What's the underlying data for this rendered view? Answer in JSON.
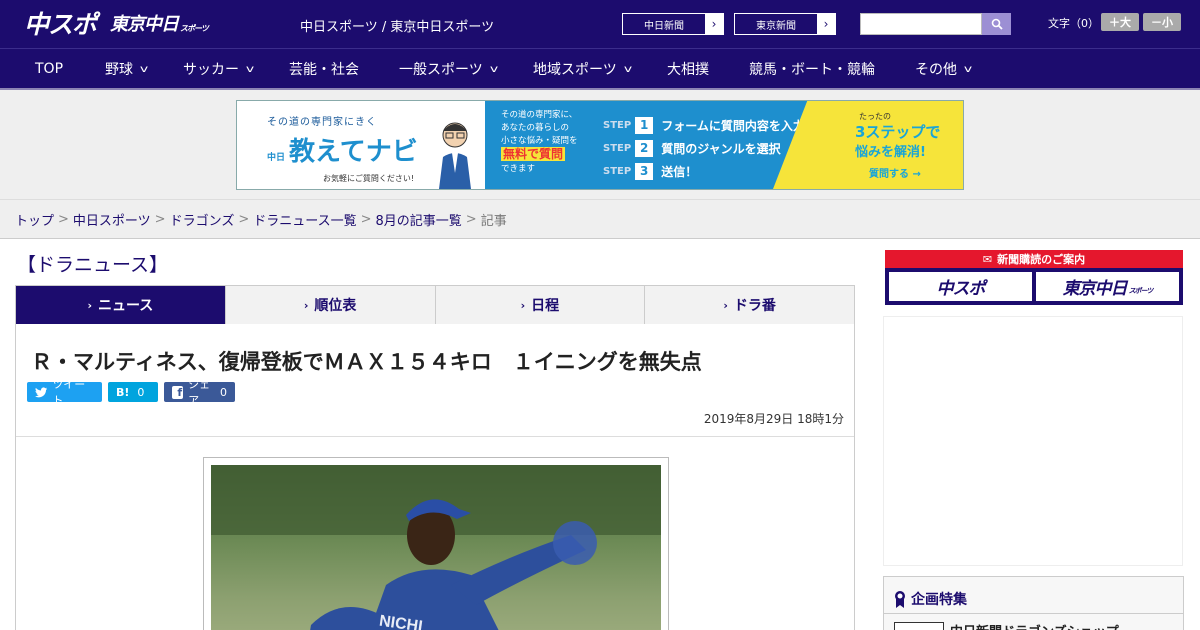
{
  "header": {
    "logo_chuspo": "中スポ",
    "logo_tokyo": "東京中日",
    "logo_tokyo_small": "スポーツ",
    "site_name": "中日スポーツ / 東京中日スポーツ",
    "paper_buttons": [
      {
        "label": "中日新聞"
      },
      {
        "label": "東京新聞"
      }
    ],
    "search_placeholder": "",
    "font_label": "文字（0）",
    "font_bigger": "＋大",
    "font_smaller": "－小"
  },
  "nav": [
    {
      "label": "TOP",
      "has_menu": false
    },
    {
      "label": "野球",
      "has_menu": true
    },
    {
      "label": "サッカー",
      "has_menu": true
    },
    {
      "label": "芸能・社会",
      "has_menu": false
    },
    {
      "label": "一般スポーツ",
      "has_menu": true
    },
    {
      "label": "地域スポーツ",
      "has_menu": true
    },
    {
      "label": "大相撲",
      "has_menu": false
    },
    {
      "label": "競馬・ボート・競輪",
      "has_menu": false
    },
    {
      "label": "その他",
      "has_menu": true
    }
  ],
  "ad_banner": {
    "tagline": "その道の専門家にきく",
    "brand_prefix": "中日",
    "brand": "教えてナビ",
    "note": "お気軽にご質問ください!",
    "mid_text_1": "その道の専門家に、",
    "mid_text_2": "あなたの暮らしの",
    "mid_text_3": "小さな悩み・疑問を",
    "mid_highlight": "無料で質問",
    "mid_text_4": "できます",
    "step_label": "STEP",
    "steps": [
      {
        "num": "1",
        "text": "フォームに質問内容を入力"
      },
      {
        "num": "2",
        "text": "質問のジャンルを選択"
      },
      {
        "num": "3",
        "text": "送信！"
      }
    ],
    "right_small": "たったの",
    "right_big": "3ステップで",
    "right_line": "悩みを解消!",
    "right_cta": "質問する →"
  },
  "breadcrumb": {
    "items": [
      "トップ",
      "中日スポーツ",
      "ドラゴンズ",
      "ドラニュース一覧",
      "8月の記事一覧"
    ],
    "current": "記事",
    "separator": ">"
  },
  "section_title": "【ドラニュース】",
  "tabs": [
    {
      "label": "ニュース",
      "active": true
    },
    {
      "label": "順位表",
      "active": false
    },
    {
      "label": "日程",
      "active": false
    },
    {
      "label": "ドラ番",
      "active": false
    }
  ],
  "article": {
    "headline": "Ｒ・マルティネス、復帰登板でＭＡＸ１５４キロ　１イニングを無失点",
    "share": {
      "tweet_label": "ツイート",
      "hatena_label": "B!",
      "hatena_count": "0",
      "facebook_label": "シェア",
      "facebook_count": "0"
    },
    "date": "2019年8月29日 18時1分"
  },
  "sidebar": {
    "subscribe_header": "新聞購読のご案内",
    "subscribe_logos": [
      "中スポ",
      "東京中日"
    ],
    "subscribe_logo_small": "スポーツ",
    "feature_title": "企画特集",
    "feature_item": "中日新聞ドラゴンズショップ"
  },
  "colors": {
    "brand_navy": "#1c0c6e",
    "ad_blue": "#1e8fce",
    "ad_yellow": "#f6e43a",
    "subscribe_red": "#e5172d",
    "twitter": "#1da1f2",
    "hatena": "#00a4de",
    "facebook": "#3b5998"
  }
}
